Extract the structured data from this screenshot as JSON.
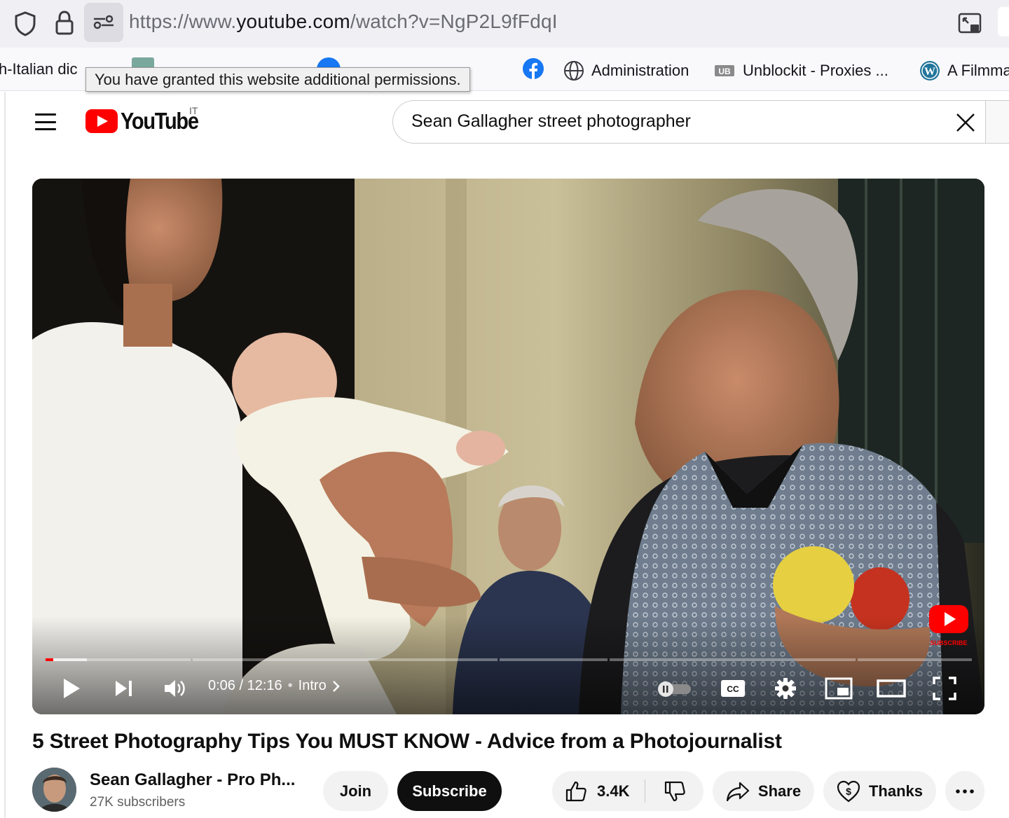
{
  "browser": {
    "url_scheme": "https://www.",
    "url_host": "youtube.com",
    "url_path": "/watch?v=NgP2L9fFdqI",
    "permissions_tooltip": "You have granted this website additional permissions."
  },
  "bookmarks": [
    {
      "label": "h-Italian dic",
      "icon": "dictionary-favicon"
    },
    {
      "label": "Administration",
      "icon": "globe-icon"
    },
    {
      "label": "Unblockit - Proxies ...",
      "icon": "unblockit-icon"
    },
    {
      "label": "A Filmma",
      "icon": "wordpress-icon"
    }
  ],
  "youtube": {
    "logo_text": "YouTube",
    "country_code": "IT",
    "search_value": "Sean Gallagher street photographer"
  },
  "player": {
    "current_time": "0:06",
    "duration": "12:16",
    "time_display": "0:06 / 12:16",
    "chapter": "Intro",
    "progress_fraction": 0.008,
    "loaded_fraction": 0.045,
    "watermark_label": "SUBSCRIBE"
  },
  "video": {
    "title": "5 Street Photography Tips You MUST KNOW - Advice from a Photojournalist",
    "channel_name": "Sean Gallagher - Pro Ph...",
    "subscribers": "27K subscribers"
  },
  "actions": {
    "join": "Join",
    "subscribe": "Subscribe",
    "likes": "3.4K",
    "share": "Share",
    "thanks": "Thanks"
  },
  "colors": {
    "youtube_red": "#ff0000",
    "subscribe_bg": "#0f0f0f",
    "pill_bg": "#f2f2f2"
  }
}
